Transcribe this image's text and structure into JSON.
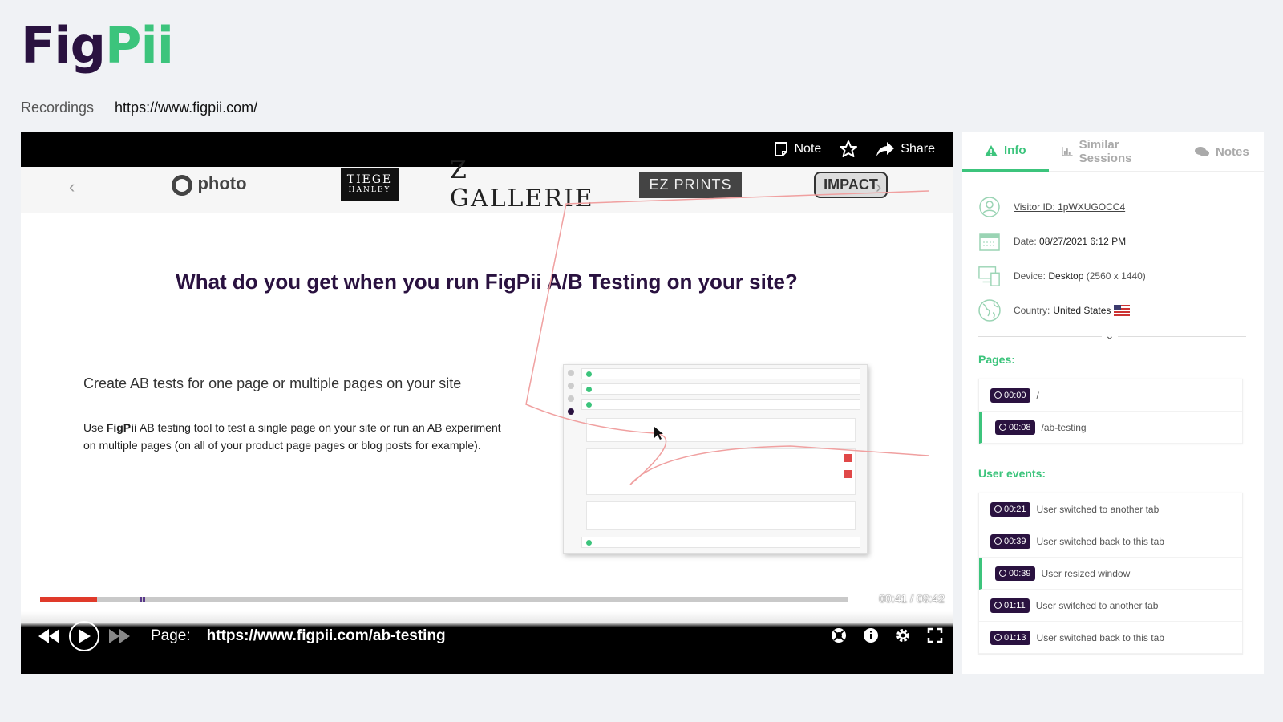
{
  "logo": {
    "part1": "Fig",
    "part2": "Pii"
  },
  "breadcrumb": {
    "recordings": "Recordings",
    "url": "https://www.figpii.com/"
  },
  "player": {
    "actions": {
      "note": "Note",
      "share": "Share"
    },
    "brands": {
      "photo": "photo",
      "tiege1": "TIEGE",
      "tiege2": "HANLEY",
      "zgallerie": "Z GALLERIE",
      "ezprints": "EZ PRINTS",
      "impact": "IMPACT"
    },
    "slide": {
      "title": "What do you get when you run FigPii A/B Testing on your site?",
      "subtitle": "Create AB tests for one page or multiple pages on your site",
      "desc_pre": "Use ",
      "desc_brand": "FigPii",
      "desc_post": " AB testing tool to test a single page on your site or run an AB experiment on multiple pages (on all of your product page pages or blog posts for example)."
    },
    "timecode": "00:41 / 09:42",
    "progress": 0.07,
    "page_label": "Page:",
    "page_url": "https://www.figpii.com/ab-testing"
  },
  "panel": {
    "tabs": {
      "info": "Info",
      "similar": "Similar Sessions",
      "notes": "Notes"
    },
    "visitor": "Visitor ID: 1pWXUGOCC4",
    "date_label": "Date:",
    "date": "08/27/2021 6:12 PM",
    "device_label": "Device:",
    "device": "Desktop",
    "device_res": "(2560 x 1440)",
    "country_label": "Country:",
    "country": "United States",
    "pages_title": "Pages:",
    "pages": [
      {
        "time": "00:00",
        "path": "/",
        "active": false
      },
      {
        "time": "00:08",
        "path": "/ab-testing",
        "active": true
      }
    ],
    "events_title": "User events:",
    "events": [
      {
        "time": "00:21",
        "text": "User switched to another tab",
        "active": false
      },
      {
        "time": "00:39",
        "text": "User switched back to this tab",
        "active": false
      },
      {
        "time": "00:39",
        "text": "User resized window",
        "active": true
      },
      {
        "time": "01:11",
        "text": "User switched to another tab",
        "active": false
      },
      {
        "time": "01:13",
        "text": "User switched back to this tab",
        "active": false
      }
    ]
  },
  "colors": {
    "brand_dark": "#2a1240",
    "brand_green": "#3cc47c",
    "progress_red": "#e03a2a"
  }
}
